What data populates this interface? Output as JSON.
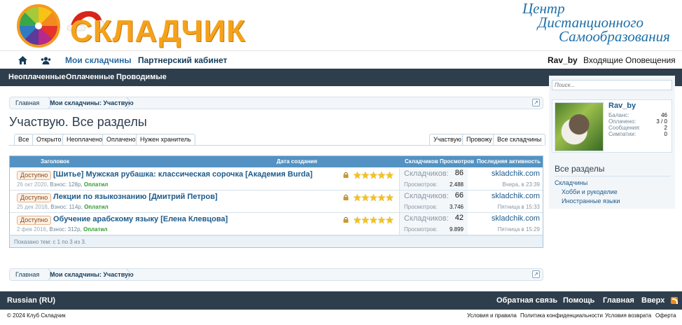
{
  "header": {
    "brand": "СКЛАДЧИК",
    "cdso_lines": [
      "Центр",
      "Дистанционного",
      "Самообразования"
    ]
  },
  "topnav": {
    "home_icon": "home-icon",
    "users_icon": "users-icon",
    "my_skladchiny": "Мои складчины",
    "partner": "Партнерский кабинет",
    "username": "Rav_by",
    "inbox": "Входящие",
    "alerts": "Оповещения"
  },
  "subnav": {
    "unpaid": "Неоплаченные",
    "paid": "Оплаченные",
    "ongoing": "Проводимые"
  },
  "breadcrumb": {
    "home": "Главная",
    "current": "Мои складчины: Участвую"
  },
  "title": "Участвую. Все разделы",
  "tabs_left": [
    "Все",
    "Открыто",
    "Неоплачено",
    "Оплачено",
    "Нужен хранитель"
  ],
  "tabs_right": [
    "Участвую",
    "Провожу",
    "Все складчины"
  ],
  "table": {
    "headers": {
      "title": "Заголовок",
      "created": "Дата создания",
      "members": "Складчиков",
      "views": "Просмотров",
      "last": "Последняя активность ↓"
    },
    "rows": [
      {
        "badge": "Доступно",
        "title": "[Шитье] Мужская рубашка: классическая сорочка [Академия Burda]",
        "date": "26 окт 2020",
        "fee": ", Взнос: 128р, ",
        "status": "Оплатил",
        "members_label": "Складчиков:",
        "members": "86",
        "views_label": "Просмотров:",
        "views": "2.488",
        "last_user": "skladchik.com",
        "last_time": "Вчера, в 23:39",
        "stars": "★★★★★"
      },
      {
        "badge": "Доступно",
        "title": "Лекции по языкознанию [Дмитрий Петров]",
        "date": "25 дек 2018",
        "fee": ", Взнос: 114р, ",
        "status": "Оплатил",
        "members_label": "Складчиков:",
        "members": "66",
        "views_label": "Просмотров:",
        "views": "3.746",
        "last_user": "skladchik.com",
        "last_time": "Пятница в 15:33",
        "stars": "★★★★★"
      },
      {
        "badge": "Доступно",
        "title": "Обучение арабскому языку [Елена Клевцова]",
        "date": "2 фев 2016",
        "fee": ", Взнос: 312р, ",
        "status": "Оплатил",
        "members_label": "Складчиков:",
        "members": "42",
        "views_label": "Просмотров:",
        "views": "9.899",
        "last_user": "skladchik.com",
        "last_time": "Пятница в 15:29",
        "stars": "★★★★★"
      }
    ],
    "footer": "Показано тем: с 1 по 3 из 3."
  },
  "sidebar": {
    "search_placeholder": "Поиск...",
    "username": "Rav_by",
    "stats": [
      {
        "label": "Баланс:",
        "value": "46"
      },
      {
        "label": "Оплачено:",
        "value": "3 / 0"
      },
      {
        "label": "Сообщения:",
        "value": "2"
      },
      {
        "label": "Симпатии:",
        "value": "0"
      }
    ],
    "sections_title": "Все разделы",
    "sections": [
      "Складчины",
      "Хобби и рукоделие",
      "Иностранные языки"
    ]
  },
  "footer": {
    "language": "Russian (RU)",
    "feedback": "Обратная связь",
    "help": "Помощь",
    "home": "Главная",
    "top": "Вверх",
    "copyright": "© 2024 Клуб Складчик",
    "terms": "Условия и правила",
    "privacy": "Политика конфиденциальности",
    "refund": "Условия возврата",
    "offer": "Оферта"
  },
  "colors": {
    "accent": "#2a6aa0",
    "nav_dark": "#2e3e4c",
    "table_head": "#5392c2",
    "brand_orange": "#f5a21b"
  }
}
